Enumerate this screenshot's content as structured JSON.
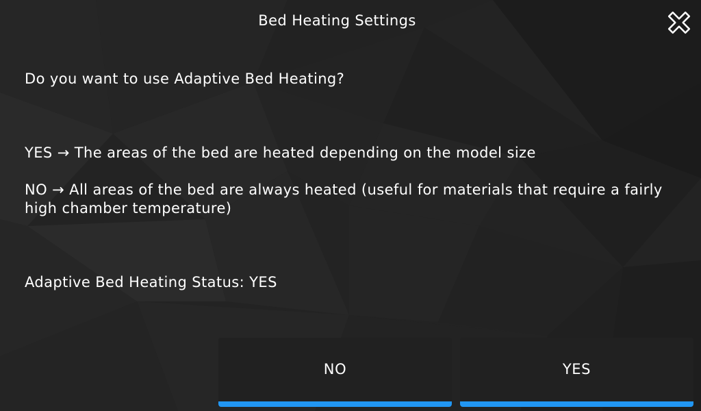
{
  "dialog": {
    "title": "Bed Heating Settings",
    "close_icon": "close-icon"
  },
  "content": {
    "question": "Do you want to use Adaptive Bed Heating?",
    "yes_description": "YES → The areas of the bed are heated depending on the model size",
    "no_description_line1": "NO → All areas of the bed are always heated (useful for materials that require a fairly",
    "no_description_line2": "high chamber temperature)",
    "status": "Adaptive Bed Heating Status: YES"
  },
  "buttons": {
    "no_label": "NO",
    "yes_label": "YES"
  },
  "colors": {
    "accent": "#2196f3",
    "background": "#232323",
    "button_bg": "#212121",
    "text": "#ffffff"
  }
}
